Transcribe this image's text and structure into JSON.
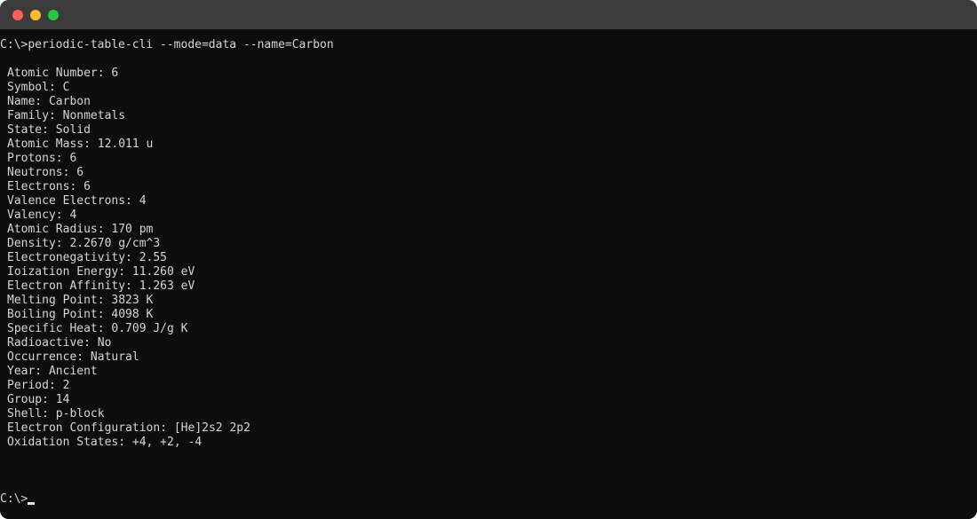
{
  "window": {
    "buttons": [
      "close",
      "minimize",
      "maximize"
    ]
  },
  "terminal": {
    "command_prompt": "C:\\>",
    "command": "periodic-table-cli --mode=data --name=Carbon",
    "output_lines": [
      "Atomic Number: 6",
      "Symbol: C",
      "Name: Carbon",
      "Family: Nonmetals",
      "State: Solid",
      "Atomic Mass: 12.011 u",
      "Protons: 6",
      "Neutrons: 6",
      "Electrons: 6",
      "Valence Electrons: 4",
      "Valency: 4",
      "Atomic Radius: 170 pm",
      "Density: 2.2670 g/cm^3",
      "Electronegativity: 2.55",
      "Ioization Energy: 11.260 eV",
      "Electron Affinity: 1.263 eV",
      "Melting Point: 3823 K",
      "Boiling Point: 4098 K",
      "Specific Heat: 0.709 J/g K",
      "Radioactive: No",
      "Occurrence: Natural",
      "Year: Ancient",
      "Period: 2",
      "Group: 14",
      "Shell: p-block",
      "Electron Configuration: [He]2s2 2p2",
      "Oxidation States: +4, +2, -4"
    ],
    "final_prompt": "C:\\>"
  },
  "colors": {
    "background": "#0d0d0d",
    "titlebar": "#3c3c3c",
    "text": "#d6d6d6",
    "close": "#ff5f57",
    "minimize": "#febc2e",
    "maximize": "#28c840"
  }
}
